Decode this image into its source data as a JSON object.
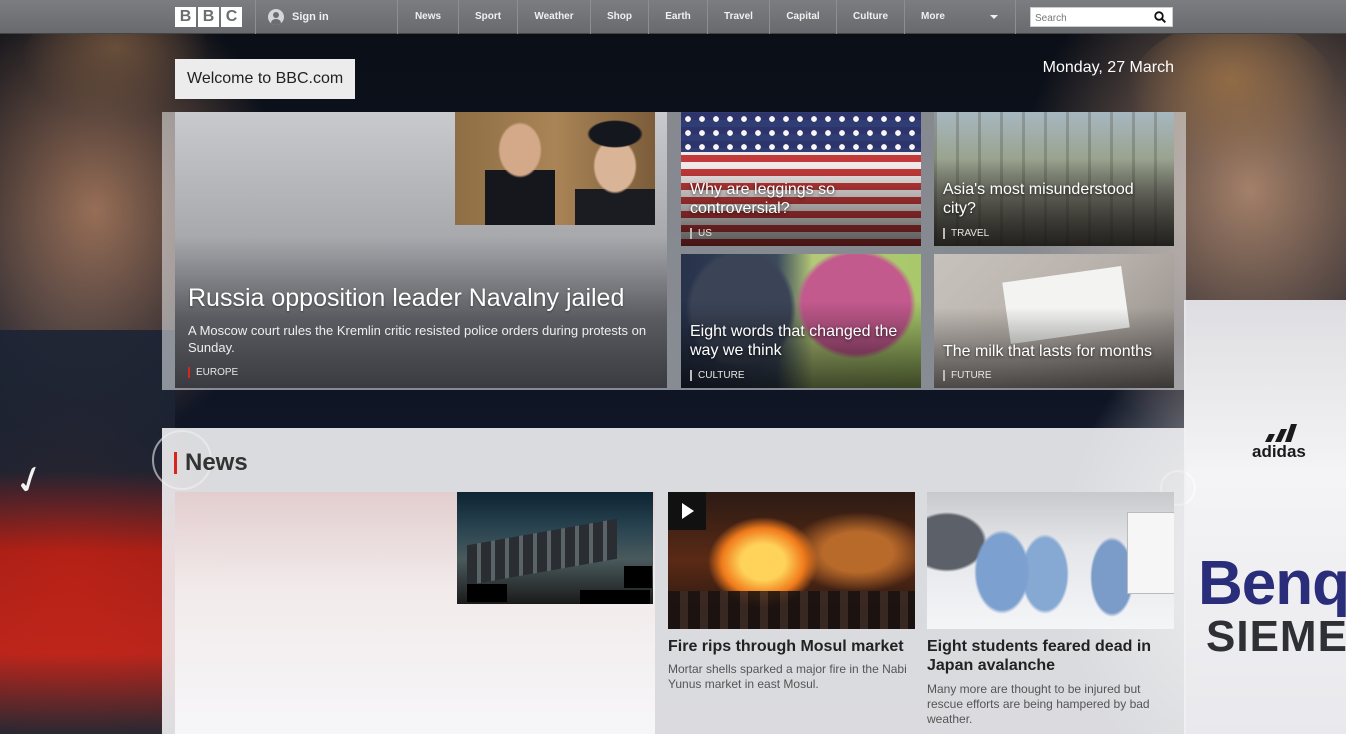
{
  "nav": {
    "logo_letters": [
      "B",
      "B",
      "C"
    ],
    "signin_label": "Sign in",
    "items": [
      "News",
      "Sport",
      "Weather",
      "Shop",
      "Earth",
      "Travel",
      "Capital",
      "Culture",
      "More"
    ],
    "search_placeholder": "Search"
  },
  "welcome_label": "Welcome to BBC.com",
  "date": "Monday, 27 March",
  "lead_story": {
    "title": "Russia opposition leader Navalny jailed",
    "summary": "A Moscow court rules the Kremlin critic resisted police orders during protests on Sunday.",
    "tag": "EUROPE"
  },
  "cards": [
    {
      "title": "Why are leggings so controversial?",
      "tag": "US"
    },
    {
      "title": "Asia's most misunderstood city?",
      "tag": "TRAVEL"
    },
    {
      "title": "Eight words that changed the way we think",
      "tag": "CULTURE"
    },
    {
      "title": "The milk that lasts for months",
      "tag": "FUTURE"
    }
  ],
  "news": {
    "heading": "News",
    "stories": [
      {
        "title": "Fire rips through Mosul market",
        "summary": "Mortar shells sparked a major fire in the Nabi Yunus market in east Mosul."
      },
      {
        "title": "Eight students feared dead in Japan avalanche",
        "summary": "Many more are thought to be injured but rescue efforts are being hampered by bad weather."
      }
    ]
  },
  "background_brands": {
    "left_shirt": "nike",
    "right_shirt_maker": "adidas",
    "right_shirt_sponsor_1": "Benq",
    "right_shirt_sponsor_2": "SIEMENS"
  },
  "colors": {
    "accent_red": "#d6251c",
    "nav_bg": "#6b6d70"
  }
}
